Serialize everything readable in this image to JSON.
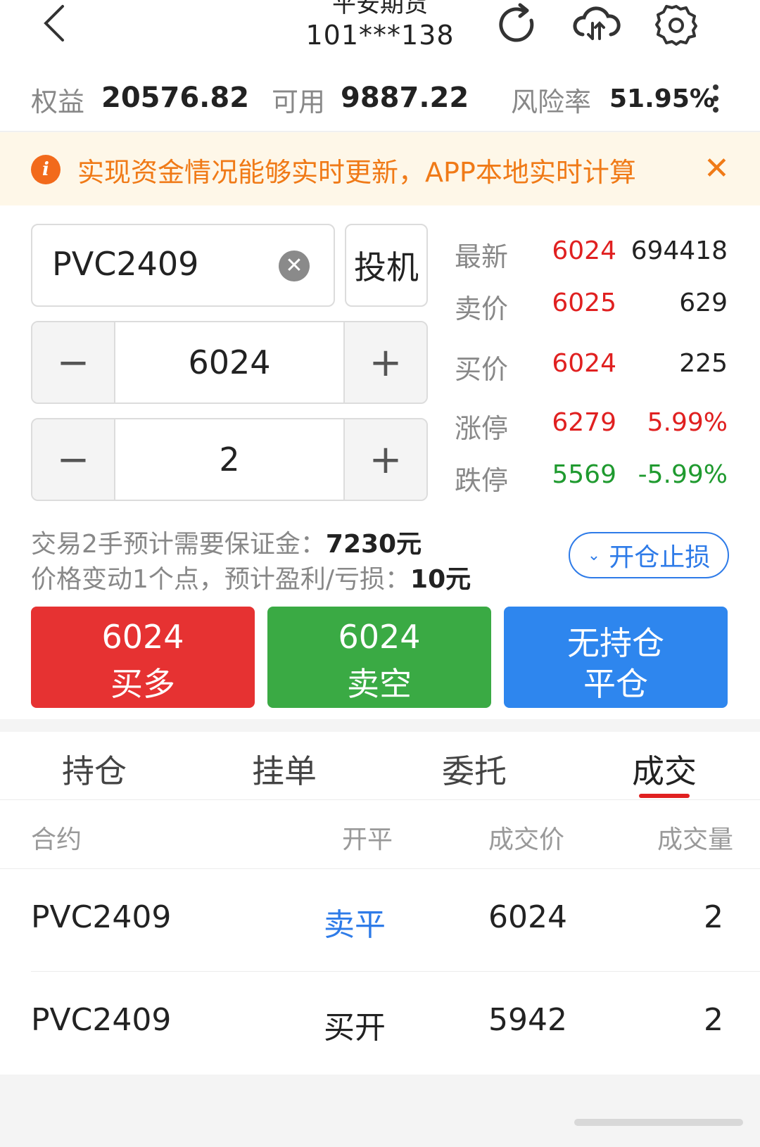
{
  "header": {
    "title": "平安期货",
    "account": "101***138",
    "icons": [
      "back-icon",
      "refresh-icon",
      "cloud-sync-icon",
      "settings-icon"
    ]
  },
  "stats": {
    "equity_label": "权益",
    "equity_value": "20576.82",
    "available_label": "可用",
    "available_value": "9887.22",
    "risk_label": "风险率",
    "risk_value": "51.95%"
  },
  "notice": {
    "text": "实现资金情况能够实时更新，APP本地实时计算",
    "close": "✕"
  },
  "order": {
    "symbol": "PVC2409",
    "hedge_type": "投机",
    "price": "6024",
    "quantity": "2",
    "margin_info": "交易2手预计需要保证金：",
    "margin_value": "7230元",
    "tick_info": "价格变动1个点，预计盈利/亏损：",
    "tick_value": "10元",
    "stop_button": "开仓止损"
  },
  "quotes": [
    {
      "label": "最新",
      "price": "6024",
      "vol": "694418",
      "price_color": "red",
      "vol_color": "black"
    },
    {
      "label": "卖价",
      "price": "6025",
      "vol": "629",
      "price_color": "red",
      "vol_color": "black"
    },
    {
      "label": "买价",
      "price": "6024",
      "vol": "225",
      "price_color": "red",
      "vol_color": "black"
    },
    {
      "label": "涨停",
      "price": "6279",
      "vol": "5.99%",
      "price_color": "red",
      "vol_color": "red"
    },
    {
      "label": "跌停",
      "price": "5569",
      "vol": "-5.99%",
      "price_color": "green",
      "vol_color": "green"
    }
  ],
  "actions": {
    "buy_price": "6024",
    "buy_label": "买多",
    "sell_price": "6024",
    "sell_label": "卖空",
    "close_line1": "无持仓",
    "close_line2": "平仓"
  },
  "tabs": [
    "持仓",
    "挂单",
    "委托",
    "成交"
  ],
  "active_tab": "成交",
  "table": {
    "headers": [
      "合约",
      "开平",
      "成交价",
      "成交量"
    ],
    "rows": [
      {
        "contract": "PVC2409",
        "open_close": "卖平",
        "price": "6024",
        "volume": "2"
      },
      {
        "contract": "PVC2409",
        "open_close": "买开",
        "price": "5942",
        "volume": "2"
      }
    ]
  },
  "colors": {
    "buy": "#e63232",
    "sell": "#3aaa44",
    "close": "#2e86ee",
    "notice_bg": "#fef7e8",
    "notice_text": "#f07a17",
    "up": "#e02020",
    "down": "#1f9a2f",
    "link": "#2e7be8"
  }
}
